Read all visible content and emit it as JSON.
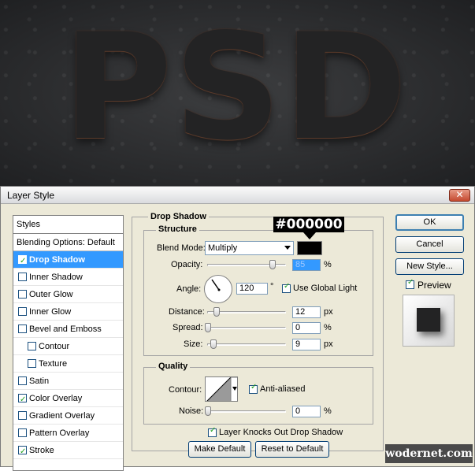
{
  "canvas": {
    "text": "PSD"
  },
  "dialog": {
    "title": "Layer Style",
    "close_glyph": "✕"
  },
  "styles_panel": {
    "header": "Styles",
    "blending_options": "Blending Options: Default",
    "items": [
      {
        "label": "Drop Shadow",
        "checked": true,
        "selected": true
      },
      {
        "label": "Inner Shadow",
        "checked": false
      },
      {
        "label": "Outer Glow",
        "checked": false
      },
      {
        "label": "Inner Glow",
        "checked": false
      },
      {
        "label": "Bevel and Emboss",
        "checked": false
      },
      {
        "label": "Contour",
        "checked": false,
        "indent": true
      },
      {
        "label": "Texture",
        "checked": false,
        "indent": true
      },
      {
        "label": "Satin",
        "checked": false
      },
      {
        "label": "Color Overlay",
        "checked": true
      },
      {
        "label": "Gradient Overlay",
        "checked": false
      },
      {
        "label": "Pattern Overlay",
        "checked": false
      },
      {
        "label": "Stroke",
        "checked": true
      }
    ]
  },
  "drop_shadow": {
    "title": "Drop Shadow",
    "structure": {
      "title": "Structure",
      "blend_mode_label": "Blend Mode:",
      "blend_mode_value": "Multiply",
      "shadow_color": "#000000",
      "opacity_label": "Opacity:",
      "opacity_value": "85",
      "opacity_unit": "%",
      "opacity_level": 85,
      "angle_label": "Angle:",
      "angle_value": "120",
      "angle_unit": "°",
      "use_global_light_label": "Use Global Light",
      "use_global_light": true,
      "distance_label": "Distance:",
      "distance_value": "12",
      "distance_unit": "px",
      "spread_label": "Spread:",
      "spread_value": "0",
      "spread_unit": "%",
      "size_label": "Size:",
      "size_value": "9",
      "size_unit": "px"
    },
    "quality": {
      "title": "Quality",
      "contour_label": "Contour:",
      "anti_aliased_label": "Anti-aliased",
      "anti_aliased": true,
      "noise_label": "Noise:",
      "noise_value": "0",
      "noise_unit": "%"
    },
    "knocks_out_label": "Layer Knocks Out Drop Shadow",
    "knocks_out": true,
    "make_default_label": "Make Default",
    "reset_default_label": "Reset to Default"
  },
  "color_callout": "#000000",
  "right_buttons": {
    "ok": "OK",
    "cancel": "Cancel",
    "new_style": "New Style...",
    "preview_label": "Preview",
    "preview_checked": true
  },
  "watermark": "wodernet.com"
}
